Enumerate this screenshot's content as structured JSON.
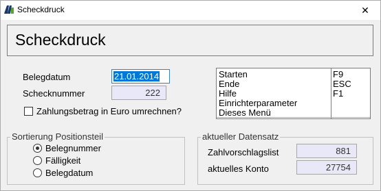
{
  "window": {
    "title": "Scheckdruck",
    "close_label": "✕"
  },
  "header": {
    "title": "Scheckdruck"
  },
  "form": {
    "belegdatum_label": "Belegdatum",
    "belegdatum_value": "21.01.2014",
    "schecknummer_label": "Schecknummer",
    "schecknummer_value": "222",
    "convert_label": "Zahlungsbetrag in Euro umrechnen?",
    "convert_checked": false
  },
  "menu": {
    "items": [
      {
        "label": "Starten",
        "key": "F9"
      },
      {
        "label": "Ende",
        "key": "ESC"
      },
      {
        "label": "Hilfe",
        "key": "F1"
      },
      {
        "label": "Einrichterparameter",
        "key": ""
      },
      {
        "label": "Dieses Menü",
        "key": ""
      }
    ]
  },
  "sort_group": {
    "title": "Sortierung Positionsteil",
    "options": [
      {
        "label": "Belegnummer",
        "selected": true
      },
      {
        "label": "Fälligkeit",
        "selected": false
      },
      {
        "label": "Belegdatum",
        "selected": false
      }
    ]
  },
  "dataset_group": {
    "title": "aktueller Datensatz",
    "zahlvorschlag_label": "Zahlvorschlagslist",
    "zahlvorschlag_value": "881",
    "konto_label": "aktuelles Konto",
    "konto_value": "27754"
  },
  "colors": {
    "field_bg": "#e8e8f8",
    "selection": "#0078d7",
    "logo_dark": "#1a3a6b",
    "logo_green": "#5aa02c"
  }
}
